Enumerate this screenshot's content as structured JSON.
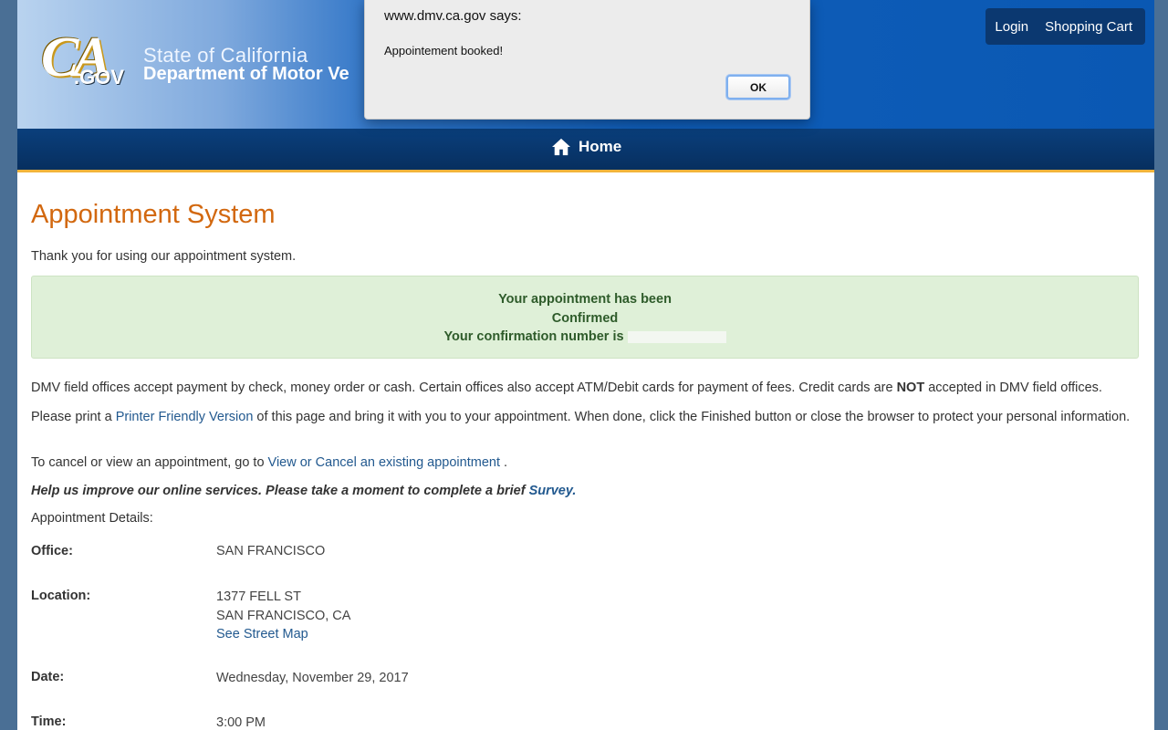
{
  "header": {
    "logo_ca": "CA",
    "logo_gov": ".GOV",
    "state_title": "State of California",
    "dept_title": "Department of Motor Ve",
    "nav": {
      "login": "Login",
      "cart": "Shopping Cart"
    }
  },
  "navbar": {
    "home_label": "Home"
  },
  "dialog": {
    "title": "www.dmv.ca.gov says:",
    "message": "Appointement booked!",
    "ok_label": "OK"
  },
  "main": {
    "title": "Appointment System",
    "thanks": "Thank you for using our appointment system.",
    "alert": {
      "line1": "Your appointment has been",
      "line2": "Confirmed",
      "line3": "Your confirmation number is"
    },
    "payment": {
      "before": "DMV field offices accept payment by check, money order or cash. Certain offices also accept ATM/Debit cards for payment of fees. Credit cards are ",
      "bold": "NOT",
      "after": " accepted in DMV field offices."
    },
    "print": {
      "before": "Please print a ",
      "link": "Printer Friendly Version",
      "after": " of this page and bring it with you to your appointment. When done, click the Finished button or close the browser to protect your personal information."
    },
    "cancel": {
      "before": "To cancel or view an appointment, go to ",
      "link": "View or Cancel an existing appointment",
      "after": " ."
    },
    "survey": {
      "text": "Help us improve our online services. Please take a moment to complete a brief ",
      "link": "Survey."
    },
    "details_heading": "Appointment Details:",
    "details": {
      "office_label": "Office:",
      "office_value": "SAN FRANCISCO",
      "location_label": "Location:",
      "location_line1": "1377 FELL ST",
      "location_line2": "SAN FRANCISCO, CA",
      "map_link": "See Street Map",
      "date_label": "Date:",
      "date_value": "Wednesday, November 29, 2017",
      "time_label": "Time:",
      "time_value": "3:00 PM"
    }
  }
}
